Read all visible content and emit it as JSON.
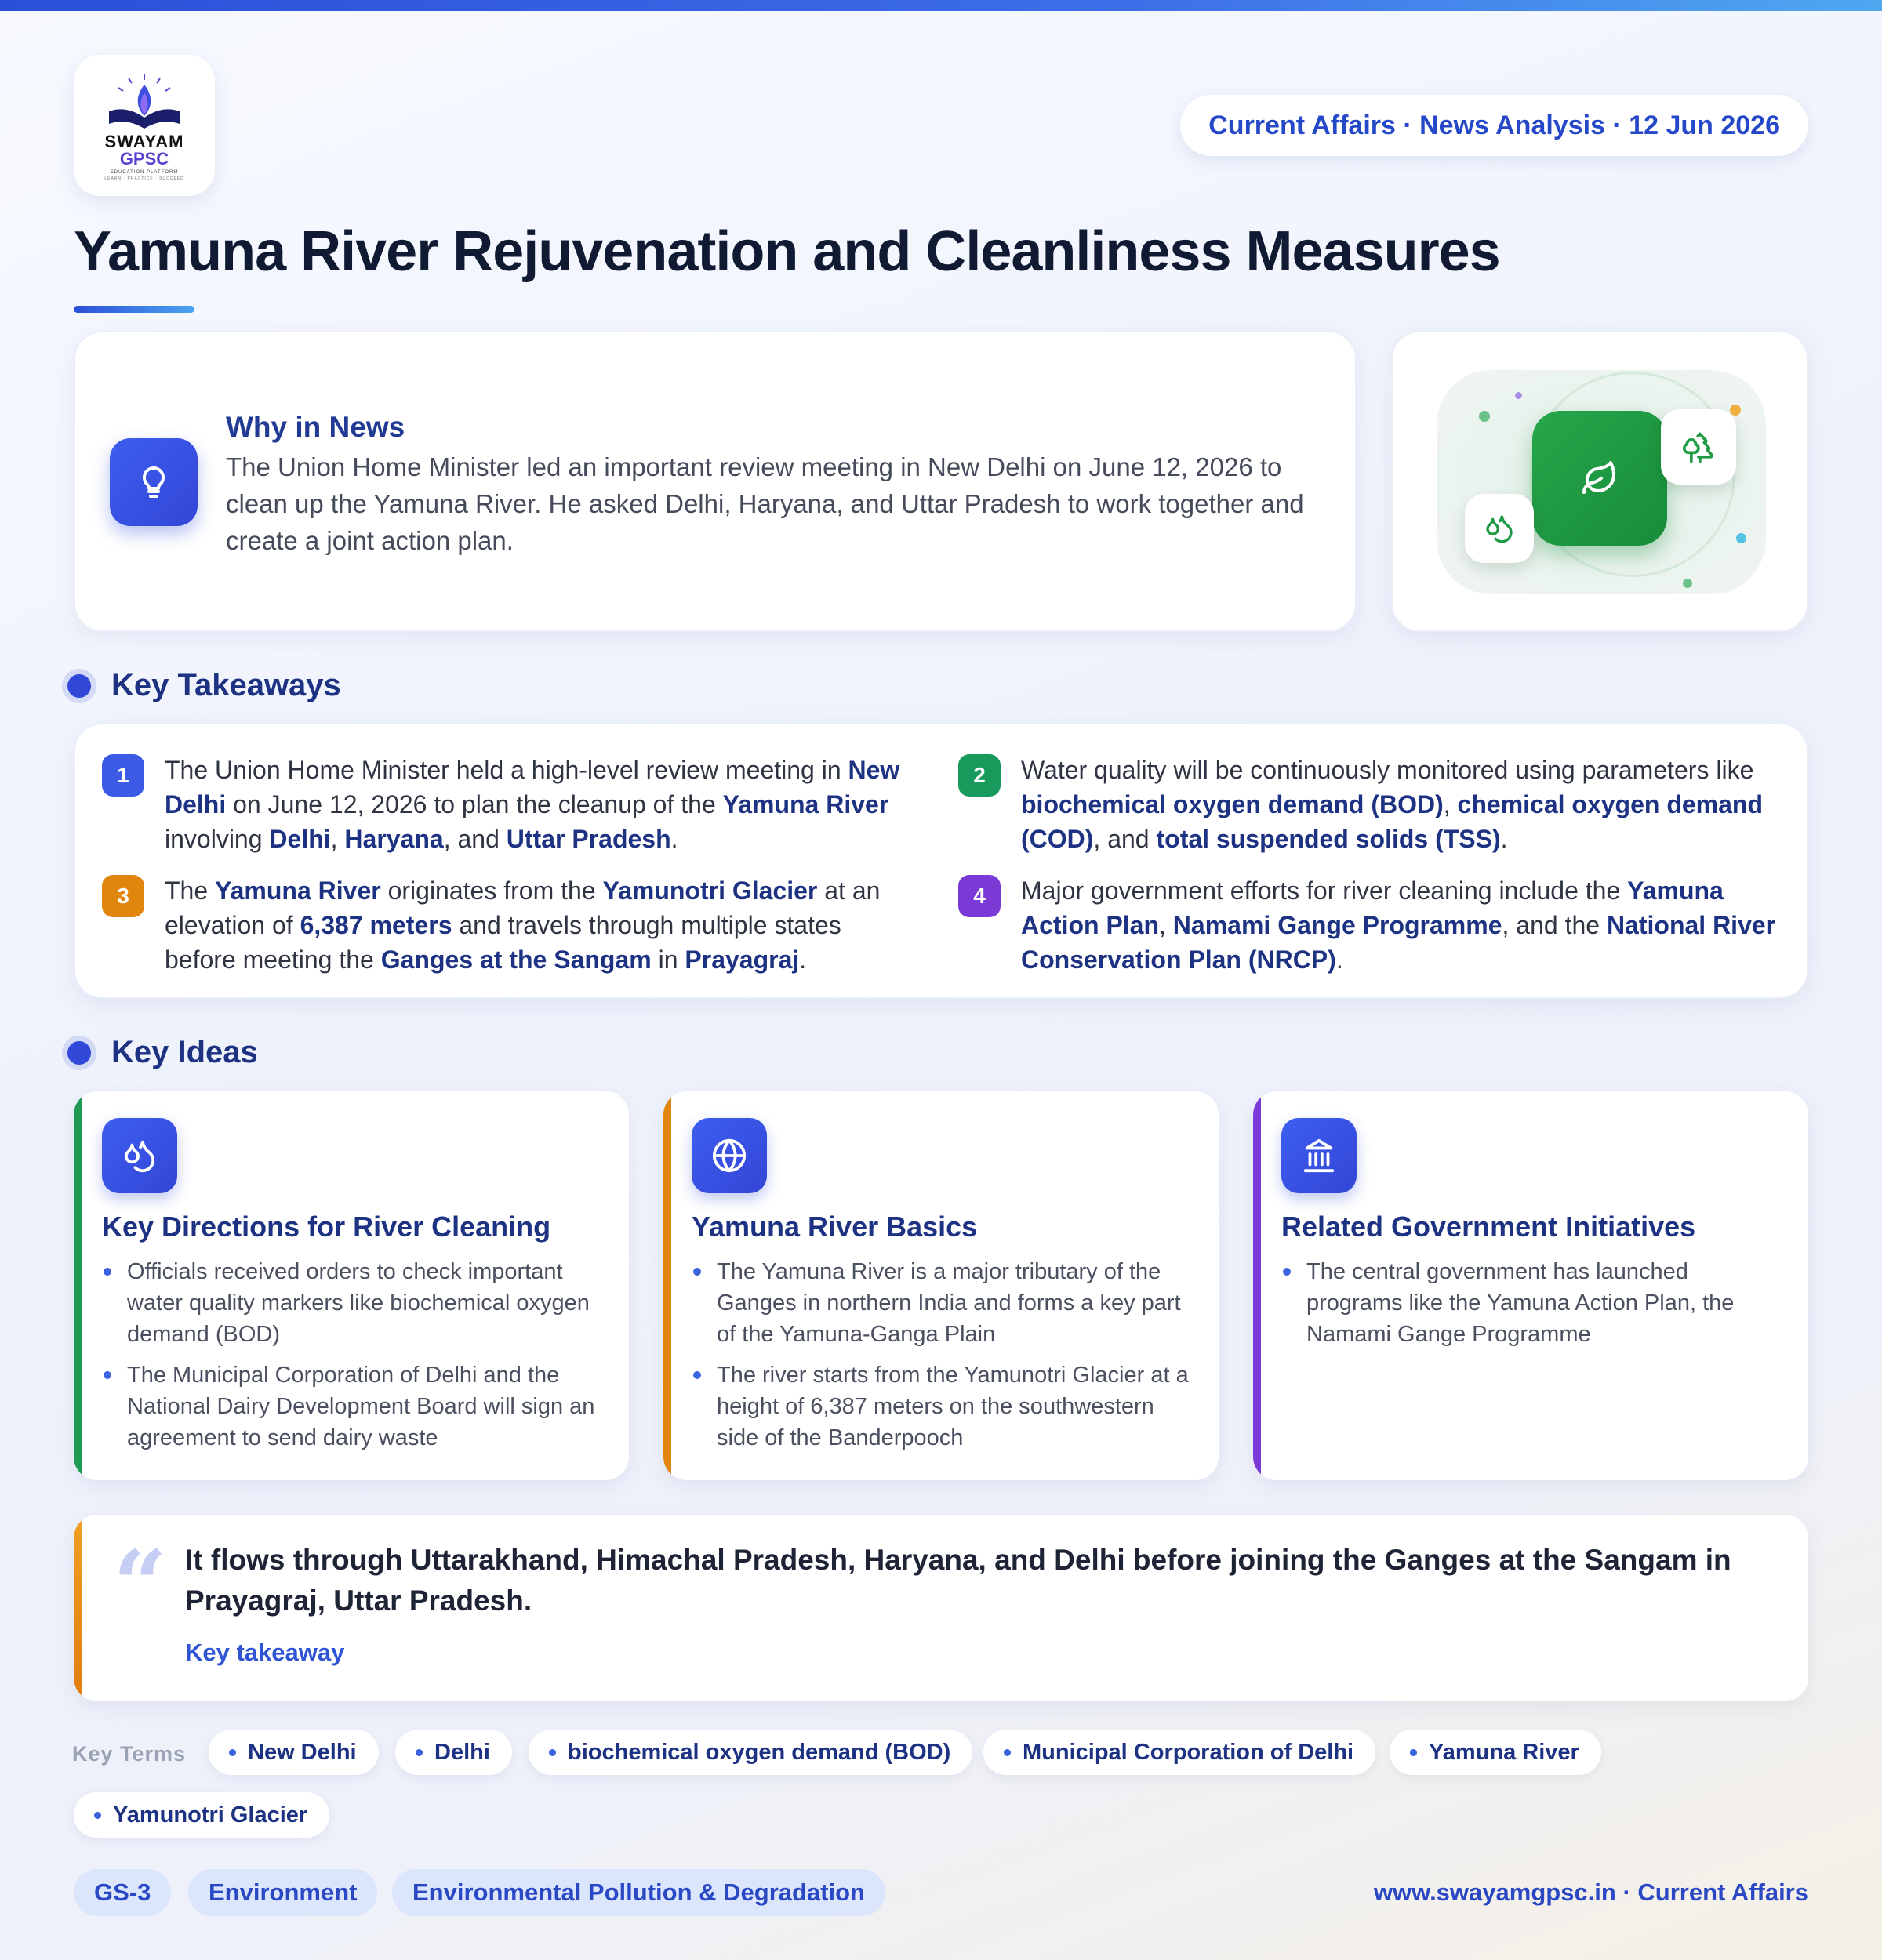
{
  "brand": {
    "logo_line1": "SWAYAM",
    "logo_line2": "GPSC",
    "logo_line3": "EDUCATION PLATFORM",
    "logo_line4": "LEARN · PRACTICE · SUCCEED"
  },
  "header": {
    "date_pill": "Current Affairs · News Analysis · 12 Jun 2026",
    "title": "Yamuna River Rejuvenation and Cleanliness Measures"
  },
  "news": {
    "heading": "Why in News",
    "body": "The Union Home Minister led an important review meeting in New Delhi on June 12, 2026 to clean up the Yamuna River. He asked Delhi, Haryana, and Uttar Pradesh to work together and create a joint action plan.",
    "icon": "lightbulb-icon"
  },
  "illustration": {
    "main_icon": "leaf-icon",
    "side_icons": [
      "trees-icon",
      "droplets-icon"
    ],
    "accent": "#1f9a45"
  },
  "takeaways": {
    "heading": "Key Takeaways",
    "items": [
      {
        "num": "1",
        "color": "#3b5be6",
        "parts": [
          {
            "t": "The Union Home Minister held a high-level review meeting in ",
            "b": false
          },
          {
            "t": "New Delhi",
            "b": true
          },
          {
            "t": " on June 12, 2026 to plan the cleanup of the ",
            "b": false
          },
          {
            "t": "Yamuna River",
            "b": true
          },
          {
            "t": " involving ",
            "b": false
          },
          {
            "t": "Delhi",
            "b": true
          },
          {
            "t": ", ",
            "b": false
          },
          {
            "t": "Haryana",
            "b": true
          },
          {
            "t": ", and ",
            "b": false
          },
          {
            "t": "Uttar Pradesh",
            "b": true
          },
          {
            "t": ".",
            "b": false
          }
        ]
      },
      {
        "num": "2",
        "color": "#189a5c",
        "parts": [
          {
            "t": "Water quality will be continuously monitored using parameters like ",
            "b": false
          },
          {
            "t": "biochemical oxygen demand (BOD)",
            "b": true
          },
          {
            "t": ", ",
            "b": false
          },
          {
            "t": "chemical oxygen demand (COD)",
            "b": true
          },
          {
            "t": ", and ",
            "b": false
          },
          {
            "t": "total suspended solids (TSS)",
            "b": true
          },
          {
            "t": ".",
            "b": false
          }
        ]
      },
      {
        "num": "3",
        "color": "#e0860f",
        "parts": [
          {
            "t": "The ",
            "b": false
          },
          {
            "t": "Yamuna River",
            "b": true
          },
          {
            "t": " originates from the ",
            "b": false
          },
          {
            "t": "Yamunotri Glacier",
            "b": true
          },
          {
            "t": " at an elevation of ",
            "b": false
          },
          {
            "t": "6,387 meters",
            "b": true
          },
          {
            "t": " and travels through multiple states before meeting the ",
            "b": false
          },
          {
            "t": "Ganges at the Sangam",
            "b": true
          },
          {
            "t": " in ",
            "b": false
          },
          {
            "t": "Prayagraj",
            "b": true
          },
          {
            "t": ".",
            "b": false
          }
        ]
      },
      {
        "num": "4",
        "color": "#7b3ad6",
        "parts": [
          {
            "t": "Major government efforts for river cleaning include the ",
            "b": false
          },
          {
            "t": "Yamuna Action Plan",
            "b": true
          },
          {
            "t": ", ",
            "b": false
          },
          {
            "t": "Namami Gange Programme",
            "b": true
          },
          {
            "t": ", and the ",
            "b": false
          },
          {
            "t": "National River Conservation Plan (NRCP)",
            "b": true
          },
          {
            "t": ".",
            "b": false
          }
        ]
      }
    ]
  },
  "ideas": {
    "heading": "Key Ideas",
    "cards": [
      {
        "title": "Key Directions for River Cleaning",
        "icon": "droplets-icon",
        "accent": "#1e9a55",
        "bullets": [
          "Officials received orders to check important water quality markers like biochemical oxygen demand (BOD)",
          "The Municipal Corporation of Delhi and the National Dairy Development Board will sign an agreement to send dairy waste"
        ]
      },
      {
        "title": "Yamuna River Basics",
        "icon": "globe-icon",
        "accent": "#e0860f",
        "bullets": [
          "The Yamuna River is a major tributary of the Ganges in northern India and forms a key part of the Yamuna-Ganga Plain",
          "The river starts from the Yamunotri Glacier at a height of 6,387 meters on the southwestern side of the Banderpooch"
        ]
      },
      {
        "title": "Related Government Initiatives",
        "icon": "landmark-icon",
        "accent": "#7b3ad6",
        "bullets": [
          "The central government has launched programs like the Yamuna Action Plan, the Namami Gange Programme"
        ]
      }
    ]
  },
  "quote": {
    "mark": "“",
    "text": "It flows through Uttarakhand, Himachal Pradesh, Haryana, and Delhi before joining the Ganges at the Sangam in Prayagraj, Uttar Pradesh.",
    "caption": "Key takeaway"
  },
  "terms": {
    "label": "Key Terms",
    "items": [
      "New Delhi",
      "Delhi",
      "biochemical oxygen demand (BOD)",
      "Municipal Corporation of Delhi",
      "Yamuna River",
      "Yamunotri Glacier"
    ]
  },
  "tags": [
    "GS-3",
    "Environment",
    "Environmental Pollution & Degradation"
  ],
  "footer": "www.swayamgpsc.in · Current Affairs"
}
